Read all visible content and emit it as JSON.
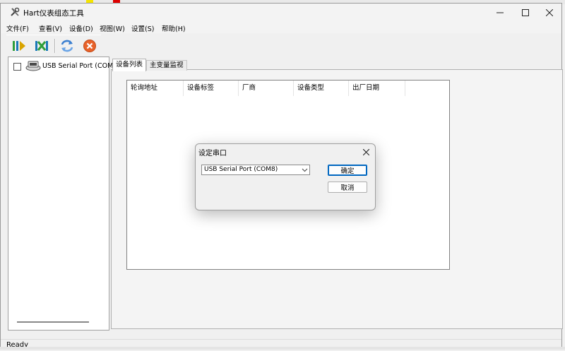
{
  "window": {
    "title": "Hart仪表组态工具"
  },
  "menu": [
    "文件(F)",
    "查看(V)",
    "设备(D)",
    "视图(W)",
    "设置(S)",
    "帮助(H)"
  ],
  "toolbar": {
    "buttons": [
      "connect-icon",
      "disconnect-icon",
      "refresh-icon",
      "stop-icon"
    ]
  },
  "tree": {
    "root_label": "USB Serial Port (COM"
  },
  "tabs": [
    "设备列表",
    "主变量监视"
  ],
  "device_list": {
    "columns": [
      "轮询地址",
      "设备标签",
      "厂商",
      "设备类型",
      "出厂日期"
    ]
  },
  "dialog": {
    "title": "设定串口",
    "port_value": "USB Serial Port (COM8)",
    "ok_label": "确定",
    "cancel_label": "取消"
  },
  "status": {
    "text": "Ready"
  },
  "colors": {
    "accent": "#0067c0",
    "stop": "#e8622a",
    "connect": "#2e9e3a"
  }
}
